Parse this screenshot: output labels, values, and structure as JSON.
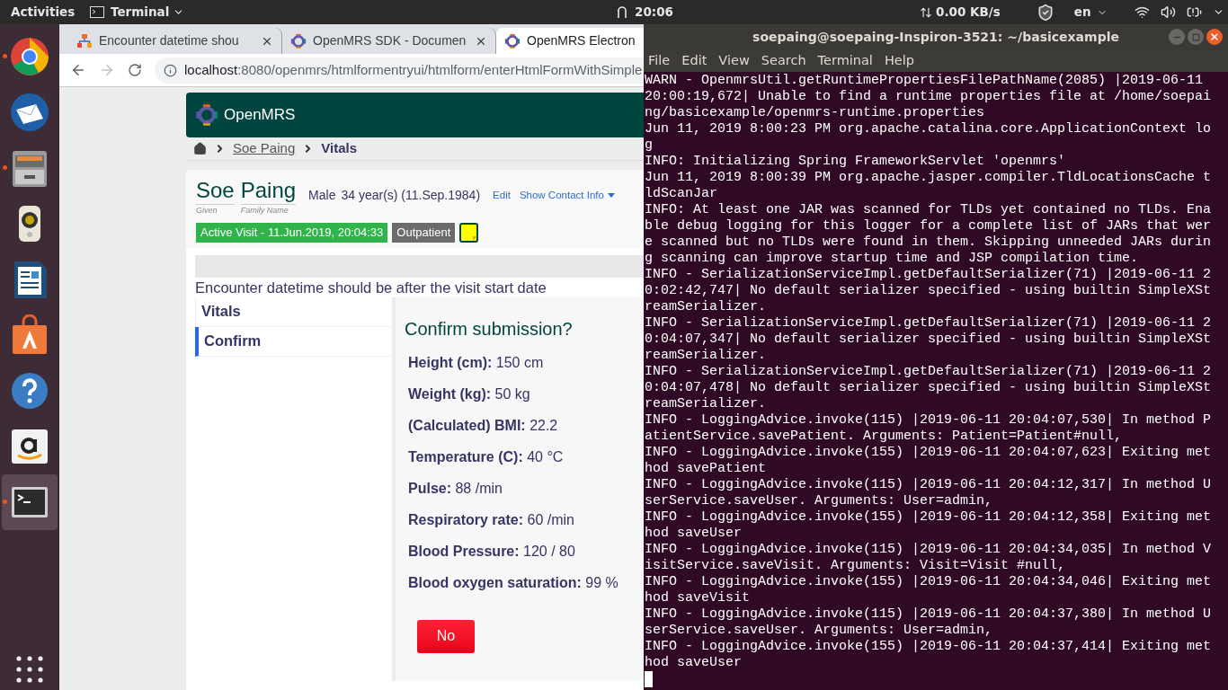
{
  "top_bar": {
    "activities": "Activities",
    "app_menu": "Terminal",
    "clock": "20:06",
    "net_speed": "0.00 KB/s",
    "language": "en"
  },
  "dock": {
    "items": [
      {
        "kind": "chrome",
        "running": true,
        "selected": false
      },
      {
        "kind": "mail",
        "running": false,
        "selected": false
      },
      {
        "kind": "files",
        "running": true,
        "selected": false
      },
      {
        "kind": "speaker",
        "running": false,
        "selected": false
      },
      {
        "kind": "writer",
        "running": false,
        "selected": false
      },
      {
        "kind": "store",
        "running": false,
        "selected": false
      },
      {
        "kind": "help",
        "running": false,
        "selected": false
      },
      {
        "kind": "amazon",
        "running": false,
        "selected": false
      },
      {
        "kind": "terminal",
        "running": true,
        "selected": true
      }
    ]
  },
  "browser": {
    "tabs": [
      {
        "title": "Encounter datetime shou",
        "kind": "jira",
        "selected": false
      },
      {
        "title": "OpenMRS SDK - Documen",
        "kind": "openmrs",
        "selected": false
      },
      {
        "title": "OpenMRS Electron",
        "kind": "openmrs",
        "selected": true
      }
    ],
    "url": {
      "host": "localhost",
      "path": ":8080/openmrs/htmlformentryui/htmlform/enterHtmlFormWithSimple"
    }
  },
  "page": {
    "logo": "OpenMRS",
    "breadcrumb": [
      {
        "label": "Soe Paing",
        "current": false
      },
      {
        "label": "Vitals",
        "current": true
      }
    ],
    "patient": {
      "given": "Soe",
      "family": "Paing",
      "given_label": "Given",
      "family_label": "Family Name",
      "gender": "Male",
      "age": "34 year(s) (11.Sep.1984)",
      "edit": "Edit",
      "contact": "Show Contact Info"
    },
    "visit_badge": "Active Visit - 11.Jun.2019, 20:04:33",
    "type_badge": "Outpatient",
    "error": "Encounter datetime should be after the visit start date",
    "sections": [
      {
        "label": "Vitals",
        "selected": false
      },
      {
        "label": "Confirm",
        "selected": true
      }
    ],
    "confirm_title": "Confirm submission?",
    "fields": [
      {
        "label": "Height (cm):",
        "value": "150 cm"
      },
      {
        "label": "Weight (kg):",
        "value": "50 kg"
      },
      {
        "label": "(Calculated) BMI:",
        "value": "22.2"
      },
      {
        "label": "Temperature (C):",
        "value": "40 °C"
      },
      {
        "label": "Pulse:",
        "value": "88 /min"
      },
      {
        "label": "Respiratory rate:",
        "value": "60 /min"
      },
      {
        "label": "Blood Pressure:",
        "value": "120 / 80"
      },
      {
        "label": "Blood oxygen saturation:",
        "value": "99 %"
      }
    ],
    "no_button": "No"
  },
  "terminal": {
    "title": "soepaing@soepaing-Inspiron-3521: ~/basicexample",
    "menu": [
      "File",
      "Edit",
      "View",
      "Search",
      "Terminal",
      "Help"
    ],
    "lines": [
      "WARN - OpenmrsUtil.getRuntimePropertiesFilePathName(2085) |2019-06-11",
      "20:00:19,672| Unable to find a runtime properties file at /home/soepai",
      "ng/basicexample/openmrs-runtime.properties",
      "Jun 11, 2019 8:00:23 PM org.apache.catalina.core.ApplicationContext lo",
      "g",
      "INFO: Initializing Spring FrameworkServlet 'openmrs'",
      "Jun 11, 2019 8:00:39 PM org.apache.jasper.compiler.TldLocationsCache t",
      "ldScanJar",
      "INFO: At least one JAR was scanned for TLDs yet contained no TLDs. Ena",
      "ble debug logging for this logger for a complete list of JARs that wer",
      "e scanned but no TLDs were found in them. Skipping unneeded JARs durin",
      "g scanning can improve startup time and JSP compilation time.",
      "INFO - SerializationServiceImpl.getDefaultSerializer(71) |2019-06-11 2",
      "0:02:42,747| No default serializer specified - using builtin SimpleXSt",
      "reamSerializer.",
      "INFO - SerializationServiceImpl.getDefaultSerializer(71) |2019-06-11 2",
      "0:04:07,347| No default serializer specified - using builtin SimpleXSt",
      "reamSerializer.",
      "INFO - SerializationServiceImpl.getDefaultSerializer(71) |2019-06-11 2",
      "0:04:07,478| No default serializer specified - using builtin SimpleXSt",
      "reamSerializer.",
      "INFO - LoggingAdvice.invoke(115) |2019-06-11 20:04:07,530| In method P",
      "atientService.savePatient. Arguments: Patient=Patient#null,",
      "INFO - LoggingAdvice.invoke(155) |2019-06-11 20:04:07,623| Exiting met",
      "hod savePatient",
      "INFO - LoggingAdvice.invoke(115) |2019-06-11 20:04:12,317| In method U",
      "serService.saveUser. Arguments: User=admin,",
      "INFO - LoggingAdvice.invoke(155) |2019-06-11 20:04:12,358| Exiting met",
      "hod saveUser",
      "INFO - LoggingAdvice.invoke(115) |2019-06-11 20:04:34,035| In method V",
      "isitService.saveVisit. Arguments: Visit=Visit #null,",
      "INFO - LoggingAdvice.invoke(155) |2019-06-11 20:04:34,046| Exiting met",
      "hod saveVisit",
      "INFO - LoggingAdvice.invoke(115) |2019-06-11 20:04:37,380| In method U",
      "serService.saveUser. Arguments: User=admin,",
      "INFO - LoggingAdvice.invoke(155) |2019-06-11 20:04:37,414| Exiting met",
      "hod saveUser"
    ]
  }
}
